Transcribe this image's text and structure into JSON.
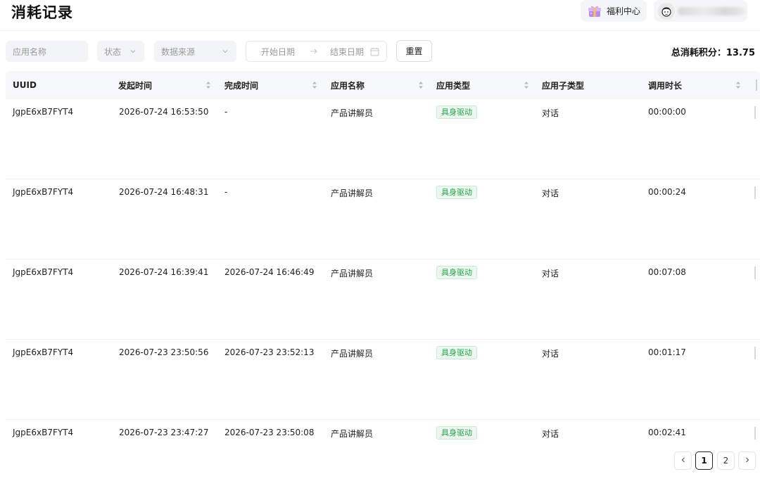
{
  "header": {
    "title": "消耗记录",
    "welfare_label": "福利中心"
  },
  "filters": {
    "app_name_placeholder": "应用名称",
    "status_placeholder": "状态",
    "source_placeholder": "数据来源",
    "start_date_placeholder": "开始日期",
    "end_date_placeholder": "结束日期",
    "reset_label": "重置"
  },
  "summary": {
    "total_label": "总消耗积分：",
    "total_value": "13.75"
  },
  "table": {
    "columns": [
      "UUID",
      "发起时间",
      "完成时间",
      "应用名称",
      "应用类型",
      "应用子类型",
      "调用时长"
    ],
    "rows": [
      {
        "uuid": "JgpE6xB7FYT4",
        "start": "2026-07-24 16:53:50",
        "end": "-",
        "app": "产品讲解员",
        "type": "具身驱动",
        "subtype": "对话",
        "duration": "00:00:00"
      },
      {
        "uuid": "JgpE6xB7FYT4",
        "start": "2026-07-24 16:48:31",
        "end": "-",
        "app": "产品讲解员",
        "type": "具身驱动",
        "subtype": "对话",
        "duration": "00:00:24"
      },
      {
        "uuid": "JgpE6xB7FYT4",
        "start": "2026-07-24 16:39:41",
        "end": "2026-07-24 16:46:49",
        "app": "产品讲解员",
        "type": "具身驱动",
        "subtype": "对话",
        "duration": "00:07:08"
      },
      {
        "uuid": "JgpE6xB7FYT4",
        "start": "2026-07-23 23:50:56",
        "end": "2026-07-23 23:52:13",
        "app": "产品讲解员",
        "type": "具身驱动",
        "subtype": "对话",
        "duration": "00:01:17"
      },
      {
        "uuid": "JgpE6xB7FYT4",
        "start": "2026-07-23 23:47:27",
        "end": "2026-07-23 23:50:08",
        "app": "产品讲解员",
        "type": "具身驱动",
        "subtype": "对话",
        "duration": "00:02:41"
      }
    ]
  },
  "pagination": {
    "pages": [
      "1",
      "2"
    ],
    "current": "1"
  },
  "icons": {
    "gift": "gift-icon",
    "avatar": "avatar-icon",
    "chevron": "chevron-down-icon",
    "arrow": "arrow-right-icon",
    "calendar": "calendar-icon",
    "sort": "sort-icon",
    "prev": "chevron-left-icon",
    "next": "chevron-right-icon"
  },
  "colors": {
    "tag_text": "#23a548",
    "tag_bg": "#ecf8ef",
    "header_bg": "#f7f8fa"
  }
}
